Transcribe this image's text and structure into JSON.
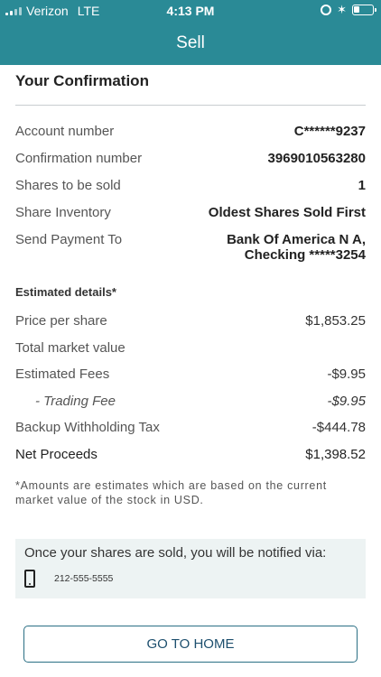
{
  "status_bar": {
    "carrier": "Verizon",
    "network": "LTE",
    "time": "4:13 PM"
  },
  "nav": {
    "title": "Sell"
  },
  "confirmation": {
    "title": "Your Confirmation",
    "rows": [
      {
        "label": "Account number",
        "value": "C******9237"
      },
      {
        "label": "Confirmation number",
        "value": "3969010563280"
      },
      {
        "label": "Shares to be sold",
        "value": "1"
      },
      {
        "label": "Share Inventory",
        "value": "Oldest Shares Sold First"
      },
      {
        "label": "Send Payment To",
        "value_line1": "Bank Of America N A,",
        "value_line2": "Checking *****3254"
      }
    ]
  },
  "estimated": {
    "heading": "Estimated details*",
    "rows": [
      {
        "label": "Price per share",
        "value": "$1,853.25"
      },
      {
        "label": "Total market value",
        "value": ""
      },
      {
        "label": "Estimated Fees",
        "value": "-$9.95"
      },
      {
        "label": "- Trading Fee",
        "value": "-$9.95"
      },
      {
        "label": "Backup Withholding Tax",
        "value": "-$444.78"
      },
      {
        "label": "Net Proceeds",
        "value": "$1,398.52"
      }
    ],
    "disclaimer": "*Amounts are estimates which are based on the current market value of the stock in USD."
  },
  "notification": {
    "text": "Once your shares are sold, you will be notified via:",
    "phone": "212-555-5555",
    "icon": "mobile-phone-icon"
  },
  "actions": {
    "home_label": "GO TO HOME"
  },
  "colors": {
    "header": "#2a8a96",
    "notify_bg": "#edf3f3",
    "button_text": "#1d4f6e"
  }
}
